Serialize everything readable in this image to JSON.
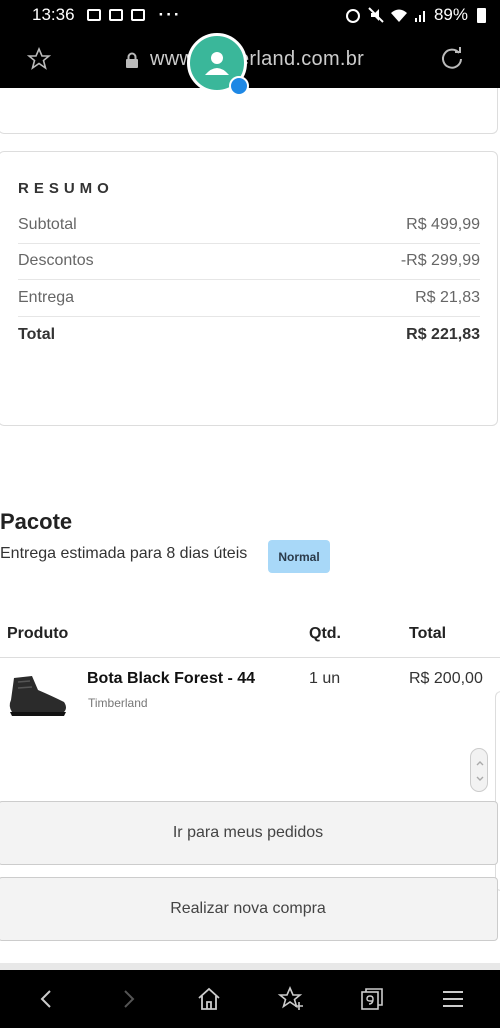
{
  "status_bar": {
    "time": "13:36",
    "dots": "···",
    "battery": "89%"
  },
  "browser": {
    "url": "www.timberland.com.br"
  },
  "summary": {
    "title": "RESUMO",
    "rows": [
      {
        "label": "Subtotal",
        "value": "R$ 499,99"
      },
      {
        "label": "Descontos",
        "value": "-R$ 299,99"
      },
      {
        "label": "Entrega",
        "value": "R$ 21,83"
      },
      {
        "label": "Total",
        "value": "R$ 221,83"
      }
    ]
  },
  "package": {
    "title": "Pacote",
    "estimate": "Entrega estimada para 8 dias úteis",
    "shipping_type": "Normal",
    "table": {
      "headers": {
        "product": "Produto",
        "qty": "Qtd.",
        "total": "Total"
      },
      "rows": [
        {
          "name": "Bota Black Forest - 44",
          "brand": "Timberland",
          "qty": "1 un",
          "total": "R$ 200,00"
        }
      ]
    }
  },
  "actions": {
    "orders": "Ir para meus pedidos",
    "new_purchase": "Realizar nova compra"
  },
  "colors": {
    "badge": "#a8d8f8",
    "avatar": "#3ab79a",
    "bars": "#000000"
  },
  "icons": [
    "star-icon",
    "lock-icon",
    "reload-icon",
    "back-icon",
    "forward-icon",
    "home-icon",
    "bookmarks-icon",
    "tabs-icon",
    "menu-icon"
  ]
}
